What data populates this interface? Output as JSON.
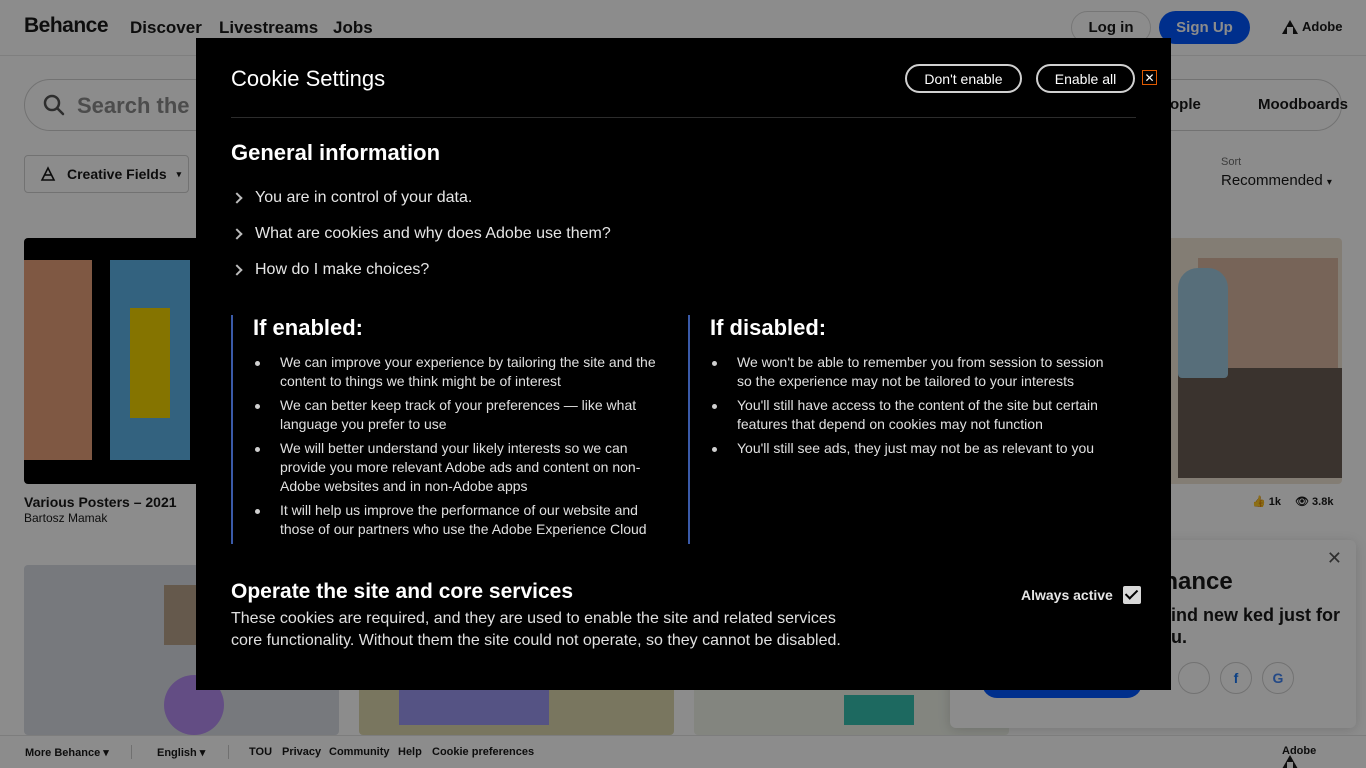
{
  "nav": {
    "logo": "Behance",
    "links": [
      "Discover",
      "Livestreams",
      "Jobs"
    ],
    "login": "Log in",
    "signup": "Sign Up",
    "adobe": "Adobe"
  },
  "search": {
    "placeholder": "Search the c",
    "tabs": [
      "ople",
      "Moodboards"
    ]
  },
  "filters": {
    "creative_fields": "Creative Fields",
    "sort_label": "Sort",
    "sort_value": "Recommended"
  },
  "projects": [
    {
      "title": "Various Posters – 2021",
      "owner": "Bartosz Mamak"
    }
  ],
  "stats": {
    "likes": "1k",
    "views": "3.8k"
  },
  "promo": {
    "title": "ehance",
    "body": ". Find new ked just for you."
  },
  "footer": {
    "more": "More Behance",
    "language": "English",
    "links": [
      "TOU",
      "Privacy",
      "Community",
      "Help",
      "Cookie preferences"
    ],
    "adobe": "Adobe"
  },
  "modal": {
    "title": "Cookie Settings",
    "dont_enable": "Don't enable",
    "enable_all": "Enable all",
    "general_heading": "General information",
    "faqs": [
      "You are in control of your data.",
      "What are cookies and why does Adobe use them?",
      "How do I make choices?"
    ],
    "enabled": {
      "heading": "If enabled:",
      "items": [
        "We can improve your experience by tailoring the site and the content to things we think might be of interest",
        "We can better keep track of your preferences — like what language you prefer to use",
        "We will better understand your likely interests so we can provide you more relevant Adobe ads and content on non-Adobe websites and in non-Adobe apps",
        "It will help us improve the performance of our website and those of our partners who use the Adobe Experience Cloud"
      ]
    },
    "disabled": {
      "heading": "If disabled:",
      "items": [
        "We won't be able to remember you from session to session so the experience may not be tailored to your interests",
        "You'll still have access to the content of the site but certain features that depend on cookies may not function",
        "You'll still see ads, they just may not be as relevant to you"
      ]
    },
    "operate": {
      "heading": "Operate the site and core services",
      "desc": "These cookies are required, and they are used to enable the site and related services core functionality. Without them the site could not operate, so they cannot be disabled.",
      "always": "Always active"
    }
  }
}
